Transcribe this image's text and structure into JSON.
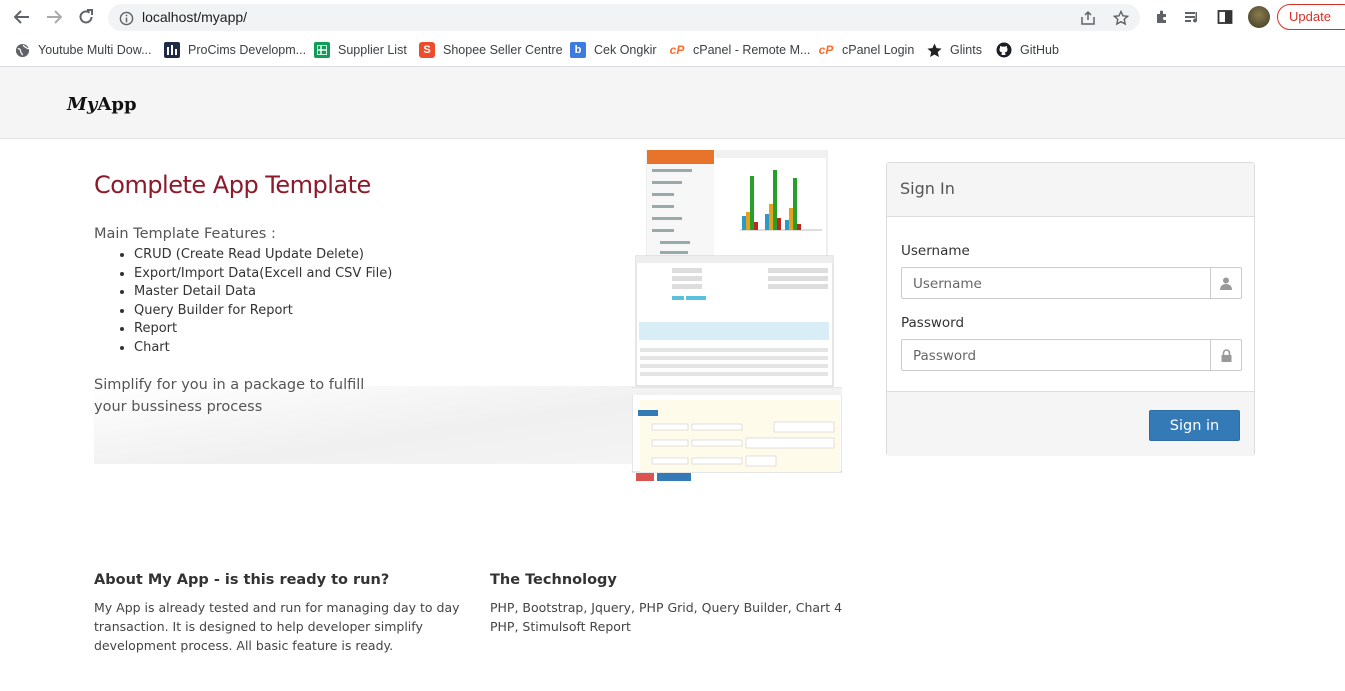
{
  "browser": {
    "url": "localhost/myapp/",
    "update_label": "Update",
    "bookmarks": [
      {
        "label": "Youtube Multi Dow...",
        "icon": "globe-icon"
      },
      {
        "label": "ProCims Developm...",
        "icon": "procims-icon"
      },
      {
        "label": "Supplier List",
        "icon": "sheets-icon"
      },
      {
        "label": "Shopee Seller Centre",
        "icon": "shopee-icon"
      },
      {
        "label": "Cek Ongkir",
        "icon": "cek-ongkir-icon"
      },
      {
        "label": "cPanel - Remote M...",
        "icon": "cpanel-icon"
      },
      {
        "label": "cPanel Login",
        "icon": "cpanel-icon"
      },
      {
        "label": "Glints",
        "icon": "glints-icon"
      },
      {
        "label": "GitHub",
        "icon": "github-icon"
      }
    ]
  },
  "navbar": {
    "brand_my": "My",
    "brand_app": "App"
  },
  "hero": {
    "title": "Complete App Template",
    "features_heading": "Main Template Features :",
    "features": [
      "CRUD (Create Read Update Delete)",
      "Export/Import Data(Excell and CSV File)",
      "Master Detail Data",
      "Query Builder for Report",
      "Report",
      "Chart"
    ],
    "tagline": "Simplify for you in a package to fulfill your bussiness process"
  },
  "login": {
    "title": "Sign In",
    "username_label": "Username",
    "username_placeholder": "Username",
    "password_label": "Password",
    "password_placeholder": "Password",
    "submit_label": "Sign in"
  },
  "about": {
    "heading": "About My App - is this ready to run?",
    "text_lines": [
      "My App is already tested and run for managing day to day",
      "transaction. It is designed to help developer simplify",
      "development process. All basic feature is ready."
    ]
  },
  "technology": {
    "heading": "The Technology",
    "text_lines": [
      "PHP, Bootstrap, Jquery, PHP Grid, Query Builder, Chart 4",
      "PHP, Stimulsoft Report"
    ]
  },
  "colors": {
    "title_red": "#8b1a2b",
    "primary_blue": "#337ab7",
    "update_red": "#d93025"
  }
}
